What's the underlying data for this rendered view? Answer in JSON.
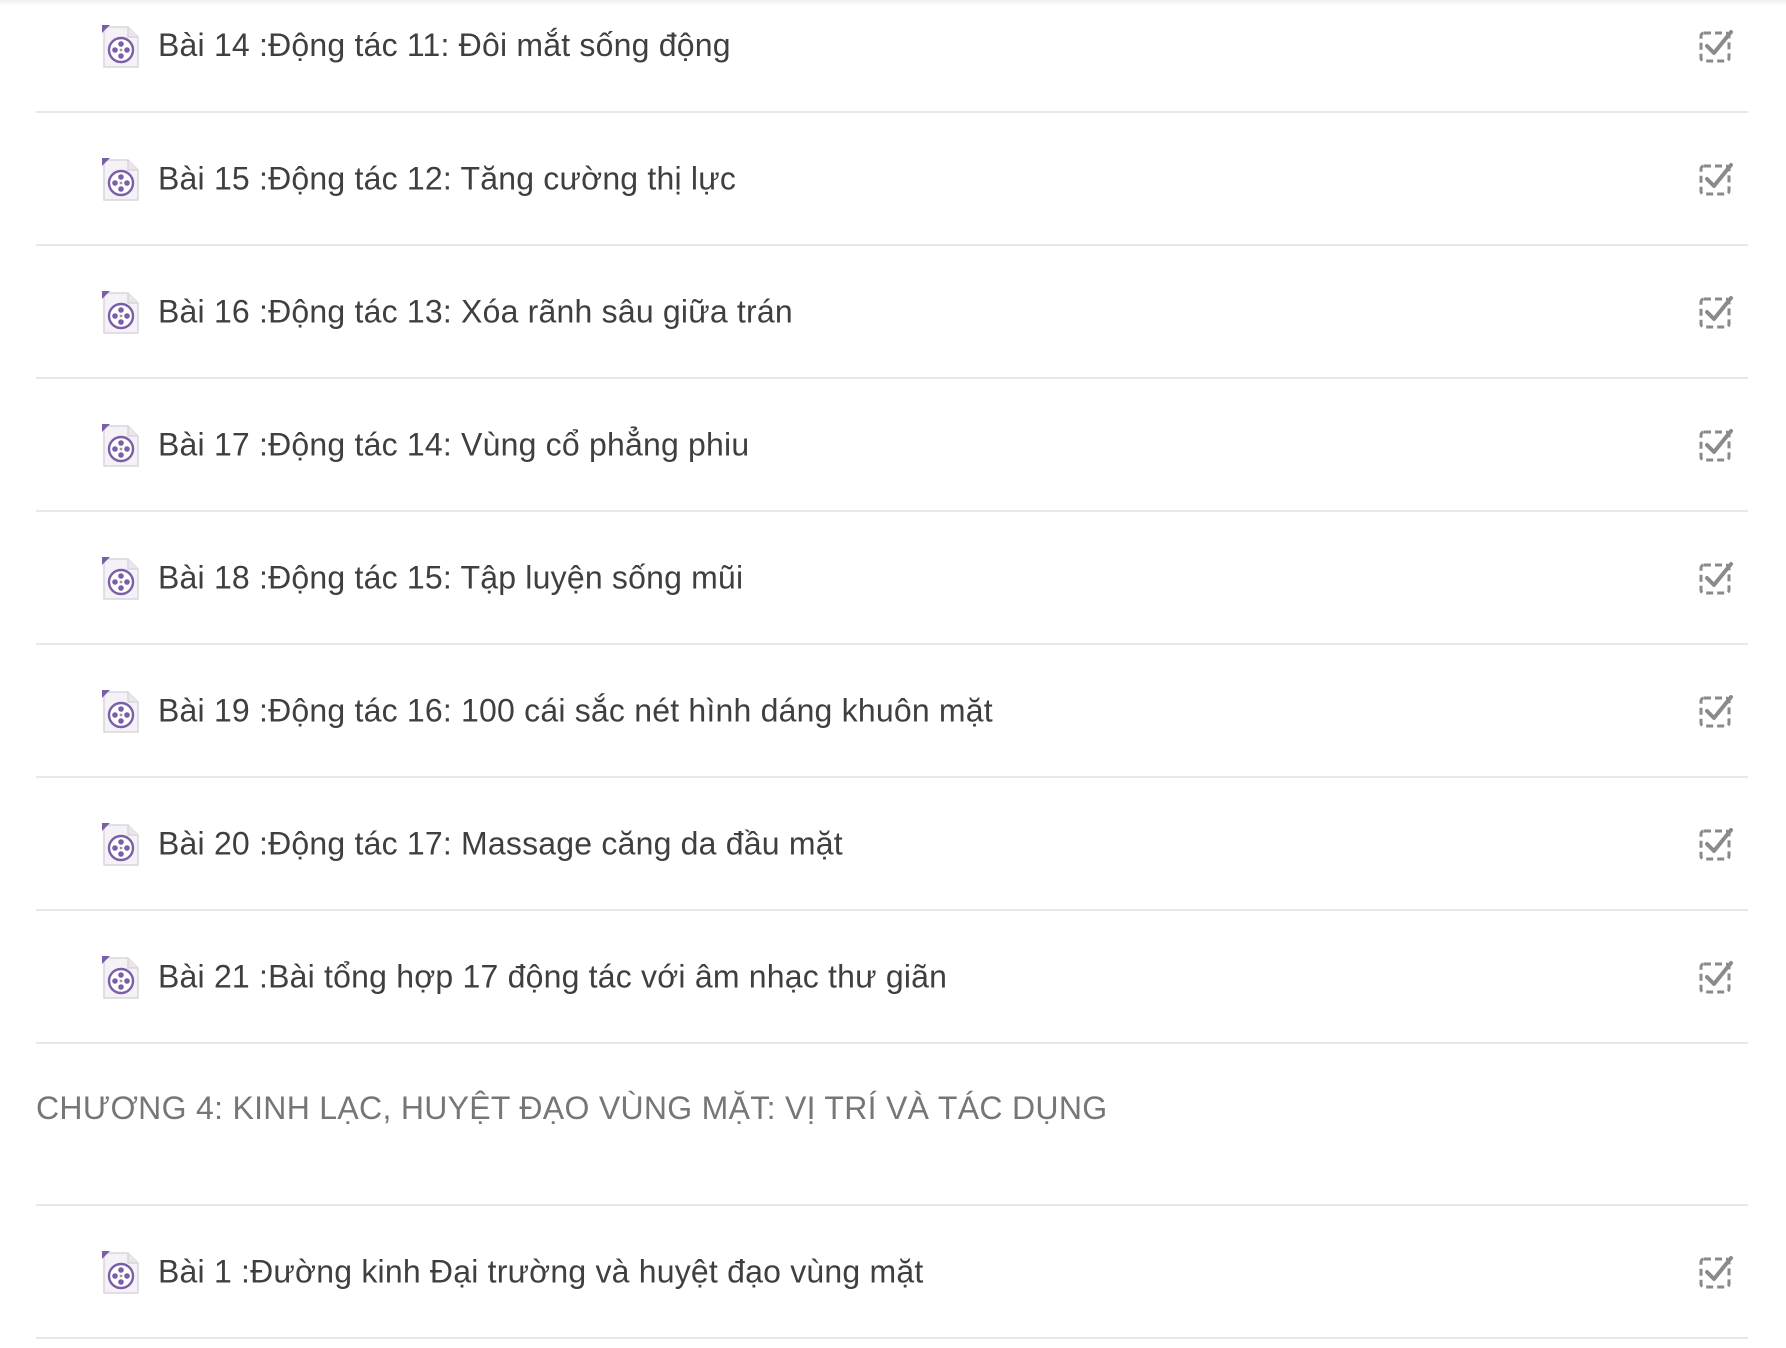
{
  "lessons_before": [
    {
      "title": "Bài 14 :Động tác 11: Đôi mắt sống động",
      "icon": "video-file-icon",
      "status_icon": "checkbox-checked-icon"
    },
    {
      "title": "Bài 15 :Động tác 12: Tăng cường thị lực",
      "icon": "video-file-icon",
      "status_icon": "checkbox-checked-icon"
    },
    {
      "title": "Bài 16 :Động tác 13: Xóa rãnh sâu giữa trán",
      "icon": "video-file-icon",
      "status_icon": "checkbox-checked-icon"
    },
    {
      "title": "Bài 17 :Động tác 14: Vùng cổ phẳng phiu",
      "icon": "video-file-icon",
      "status_icon": "checkbox-checked-icon"
    },
    {
      "title": "Bài 18 :Động tác 15: Tập luyện sống mũi",
      "icon": "video-file-icon",
      "status_icon": "checkbox-checked-icon"
    },
    {
      "title": "Bài 19 :Động tác 16: 100 cái sắc nét hình dáng khuôn mặt",
      "icon": "video-file-icon",
      "status_icon": "checkbox-checked-icon"
    },
    {
      "title": "Bài 20 :Động tác 17: Massage căng da đầu mặt",
      "icon": "video-file-icon",
      "status_icon": "checkbox-checked-icon"
    },
    {
      "title": "Bài 21 :Bài tổng hợp 17 động tác với âm nhạc thư giãn",
      "icon": "video-file-icon",
      "status_icon": "checkbox-checked-icon"
    }
  ],
  "chapter": {
    "title": "CHƯƠNG 4: KINH LẠC, HUYỆT ĐẠO VÙNG MẶT: VỊ TRÍ VÀ TÁC DỤNG"
  },
  "lessons_after": [
    {
      "title": "Bài 1 :Đường kinh Đại trường và huyệt đạo vùng mặt",
      "icon": "video-file-icon",
      "status_icon": "checkbox-checked-icon"
    }
  ],
  "colors": {
    "text": "#3f3f3f",
    "chapter_text": "#767676",
    "divider": "#e8e8e8",
    "icon_accent": "#7b5ea8",
    "check_gray": "#8a8a8a"
  }
}
